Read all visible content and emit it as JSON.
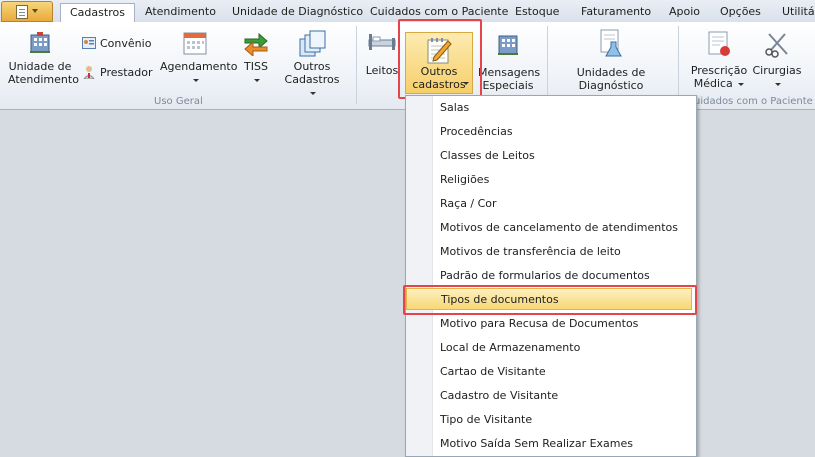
{
  "tabs": [
    "Cadastros",
    "Atendimento",
    "Unidade de Diagnóstico",
    "Cuidados com o Paciente",
    "Estoque",
    "Faturamento",
    "Apoio",
    "Opções",
    "Utilitár"
  ],
  "groups": {
    "uso_geral": {
      "label": "Uso Geral",
      "unidade_atendimento": [
        "Unidade de",
        "Atendimento"
      ],
      "convenio": "Convênio",
      "prestador": "Prestador",
      "agendamento": "Agendamento",
      "tiss": "TISS",
      "outros_cadastros": [
        "Outros",
        "Cadastros"
      ]
    },
    "cuidados": {
      "label": "uidados com o Paciente",
      "leitos": "Leitos",
      "outros_cadastros": [
        "Outros",
        "cadastros"
      ],
      "mensagens": [
        "Mensagens",
        "Especiais"
      ],
      "unidades_diagnostico": [
        "Unidades de",
        "Diagnóstico"
      ],
      "prescricao": [
        "Prescrição",
        "Médica"
      ],
      "cirurgias": "Cirurgias"
    }
  },
  "menu": {
    "items": [
      "Salas",
      "Procedências",
      "Classes de Leitos",
      "Religiões",
      "Raça / Cor",
      "Motivos de cancelamento de atendimentos",
      "Motivos de transferência de leito",
      "Padrão de formularios de documentos",
      "Tipos de documentos",
      "Motivo para Recusa de Documentos",
      "Local de Armazenamento",
      "Cartao de Visitante",
      "Cadastro de Visitante",
      "Tipo de Visitante",
      "Motivo Saída Sem Realizar Exames"
    ],
    "selected": "Tipos de documentos"
  },
  "colors": {
    "highlight_border": "#e4444a",
    "selected_fill": "#f8d874"
  }
}
